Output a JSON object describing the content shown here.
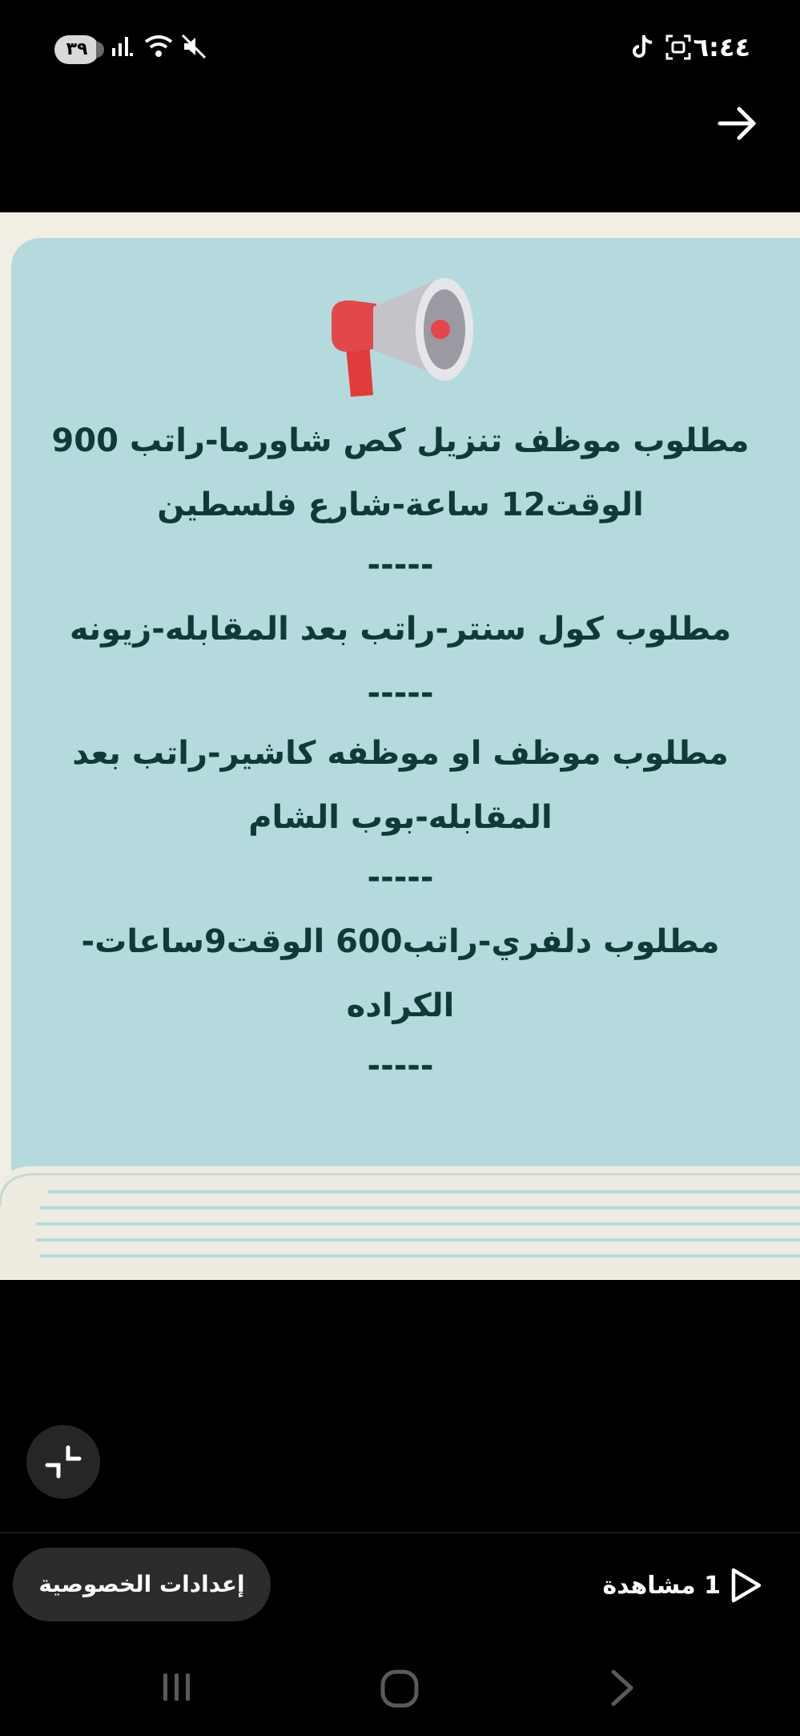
{
  "status_bar": {
    "time": "٦:٤٤",
    "battery": "٣٩"
  },
  "story": {
    "announcements": [
      "مطلوب موظف تنزيل كص شاورما-راتب 900 الوقت12 ساعة-شارع فلسطين",
      "مطلوب كول سنتر-راتب بعد المقابله-زيونه",
      "مطلوب موظف او موظفه كاشير-راتب بعد المقابله-بوب الشام",
      "مطلوب دلفري-راتب600 الوقت9ساعات-الكراده"
    ],
    "separators": [
      "-----",
      "-----",
      "-----",
      "-----"
    ]
  },
  "footer": {
    "privacy_button": "إعدادات الخصوصية",
    "views": "1 مشاهدة"
  },
  "icons": {
    "back": "arrow-right-icon",
    "megaphone": "megaphone-icon",
    "collapse": "collapse-icon",
    "views": "play-icon"
  }
}
